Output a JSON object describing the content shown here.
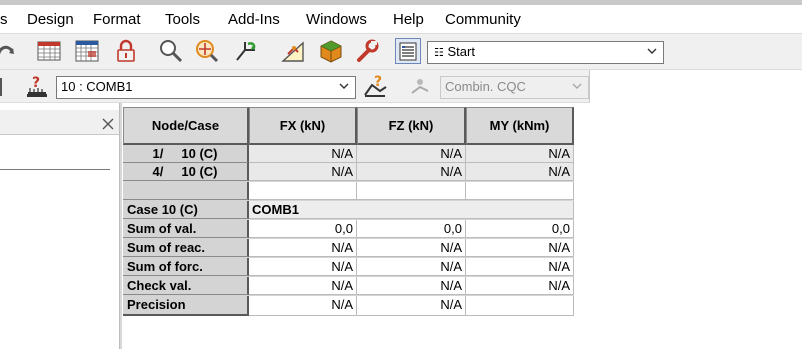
{
  "menu": [
    "s",
    "Design",
    "Format",
    "Tools",
    "Add-Ins",
    "Windows",
    "Help",
    "Community"
  ],
  "toolbar1": {
    "view_combo": {
      "value": "Start",
      "icon": "grid-mini-icon"
    }
  },
  "toolbar2": {
    "case_combo": {
      "value": "10 : COMB1"
    },
    "combination_combo": {
      "value": "Combin. CQC",
      "disabled": true
    }
  },
  "table": {
    "columns": [
      "Node/Case",
      "FX (kN)",
      "FZ (kN)",
      "MY (kNm)"
    ],
    "node_rows": [
      {
        "label": "1/     10 (C)",
        "values": [
          "N/A",
          "N/A",
          "N/A"
        ]
      },
      {
        "label": "4/     10 (C)",
        "values": [
          "N/A",
          "N/A",
          "N/A"
        ]
      }
    ],
    "case_row": {
      "label": "Case 10 (C)",
      "value": "COMB1"
    },
    "summary_rows": [
      {
        "label": "Sum of val.",
        "values": [
          "0,0",
          "0,0",
          "0,0"
        ]
      },
      {
        "label": "Sum of reac.",
        "values": [
          "N/A",
          "N/A",
          "N/A"
        ]
      },
      {
        "label": "Sum of forc.",
        "values": [
          "N/A",
          "N/A",
          "N/A"
        ]
      },
      {
        "label": "Check val.",
        "values": [
          "N/A",
          "N/A",
          "N/A"
        ]
      },
      {
        "label": "Precision",
        "values": [
          "N/A",
          "N/A",
          ""
        ]
      }
    ]
  },
  "colors": {
    "toolbar_bg": "#f0f0f0",
    "header_bg": "#d9d9d9",
    "row_header_bg": "#d4d4d4",
    "icon_red": "#c0392b",
    "icon_green": "#2e9d2e",
    "icon_orange": "#e08a1e",
    "icon_blue": "#2c5aa0"
  }
}
